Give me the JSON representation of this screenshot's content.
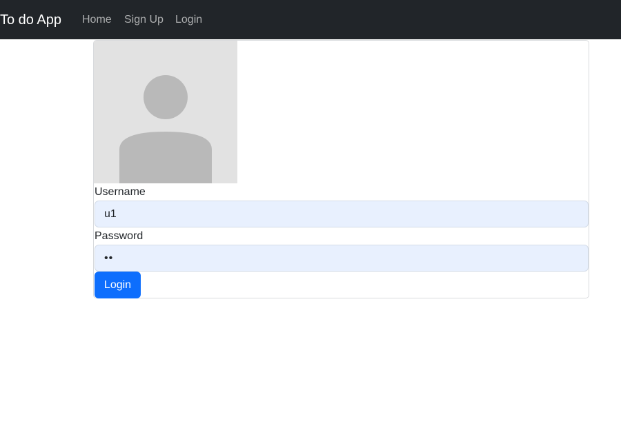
{
  "navbar": {
    "brand": "To do App",
    "links": [
      {
        "label": "Home"
      },
      {
        "label": "Sign Up"
      },
      {
        "label": "Login"
      }
    ]
  },
  "login_form": {
    "avatar_icon": "user-placeholder-icon",
    "username_label": "Username",
    "username_value": "u1",
    "password_label": "Password",
    "password_value": "••",
    "submit_label": "Login"
  },
  "colors": {
    "navbar_bg": "#212529",
    "input_bg": "#e8f0fe",
    "primary": "#0d6efd",
    "avatar_bg": "#e2e2e2",
    "avatar_fg": "#b9b9b9"
  }
}
